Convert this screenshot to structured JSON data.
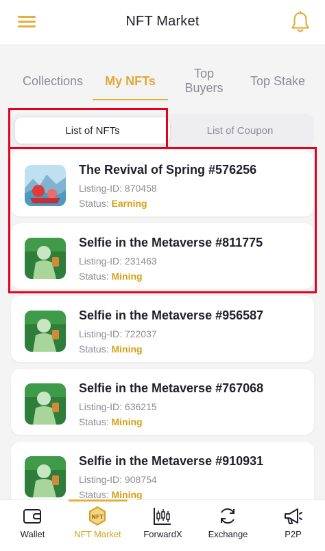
{
  "header": {
    "title": "NFT Market",
    "menu_icon": "hamburger-menu-icon",
    "bell_icon": "bell-icon"
  },
  "tabs": [
    {
      "label": "Collections",
      "active": false
    },
    {
      "label": "My NFTs",
      "active": true
    },
    {
      "label": "Top\nBuyers",
      "active": false
    },
    {
      "label": "Top Stake",
      "active": false
    }
  ],
  "segment": {
    "selected": "List of NFTs",
    "other": "List of Coupon"
  },
  "items": [
    {
      "title": "The Revival of Spring #576256",
      "listing_label": "Listing-ID:",
      "listing_id": "870458",
      "status_label": "Status:",
      "status": "Earning"
    },
    {
      "title": "Selfie in the Metaverse #811775",
      "listing_label": "Listing-ID:",
      "listing_id": "231463",
      "status_label": "Status:",
      "status": "Mining"
    },
    {
      "title": "Selfie in the Metaverse #956587",
      "listing_label": "Listing-ID:",
      "listing_id": "722037",
      "status_label": "Status:",
      "status": "Mining"
    },
    {
      "title": "Selfie in the Metaverse #767068",
      "listing_label": "Listing-ID:",
      "listing_id": "636215",
      "status_label": "Status:",
      "status": "Mining"
    },
    {
      "title": "Selfie in the Metaverse #910931",
      "listing_label": "Listing-ID:",
      "listing_id": "908754",
      "status_label": "Status:",
      "status": "Mining"
    }
  ],
  "nav": [
    {
      "label": "Wallet",
      "icon": "wallet-icon",
      "active": false
    },
    {
      "label": "NFT Market",
      "icon": "nft-icon",
      "active": true
    },
    {
      "label": "ForwardX",
      "icon": "candlestick-chart-icon",
      "active": false
    },
    {
      "label": "Exchange",
      "icon": "exchange-icon",
      "active": false
    },
    {
      "label": "P2P",
      "icon": "megaphone-icon",
      "active": false
    }
  ],
  "colors": {
    "accent": "#e0b040",
    "status": "#d4a017",
    "highlight": "#e5001b"
  }
}
